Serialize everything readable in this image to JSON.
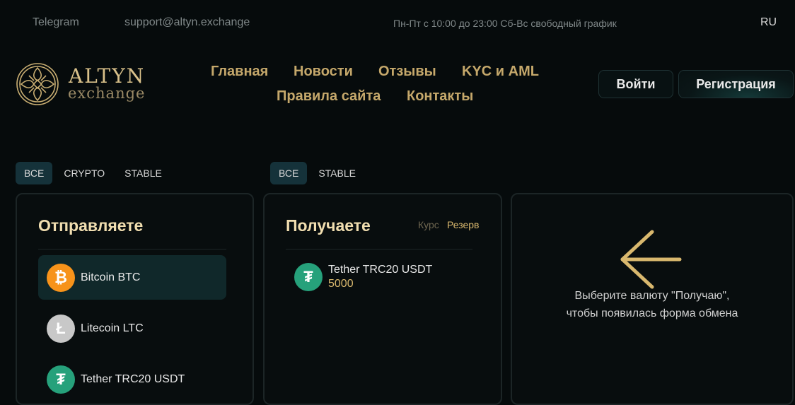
{
  "topbar": {
    "telegram": "Telegram",
    "email": "support@altyn.exchange",
    "hours": "Пн-Пт с 10:00 до 23:00 Сб-Вс свободный график",
    "lang": "RU"
  },
  "brand": {
    "name": "ALTYN",
    "sub": "exchange"
  },
  "nav": {
    "home": "Главная",
    "news": "Новости",
    "reviews": "Отзывы",
    "kyc": "KYC и AML",
    "rules": "Правила сайта",
    "contacts": "Контакты"
  },
  "auth": {
    "login": "Войти",
    "register": "Регистрация"
  },
  "send_filters": [
    "ВСЕ",
    "CRYPTO",
    "STABLE"
  ],
  "receive_filters": [
    "ВСЕ",
    "STABLE"
  ],
  "send": {
    "title": "Отправляете",
    "items": [
      {
        "label": "Bitcoin BTC",
        "icon": "bitcoin-icon",
        "color": "#f7931a"
      },
      {
        "label": "Litecoin LTC",
        "icon": "litecoin-icon",
        "color": "#c8c8c8"
      },
      {
        "label": "Tether TRC20 USDT",
        "icon": "tether-icon",
        "color": "#26a17b"
      }
    ]
  },
  "receive": {
    "title": "Получаете",
    "sort_rate": "Курс",
    "sort_reserve": "Резерв",
    "items": [
      {
        "label": "Tether TRC20 USDT",
        "reserve": "5000",
        "icon": "tether-icon",
        "color": "#26a17b"
      }
    ]
  },
  "hint": {
    "line1": "Выберите валюту \"Получаю\",",
    "line2": "чтобы появилась форма обмена"
  },
  "colors": {
    "background": "#060b0c",
    "gold": "#c5a86b",
    "accent_tab": "#15323a"
  }
}
